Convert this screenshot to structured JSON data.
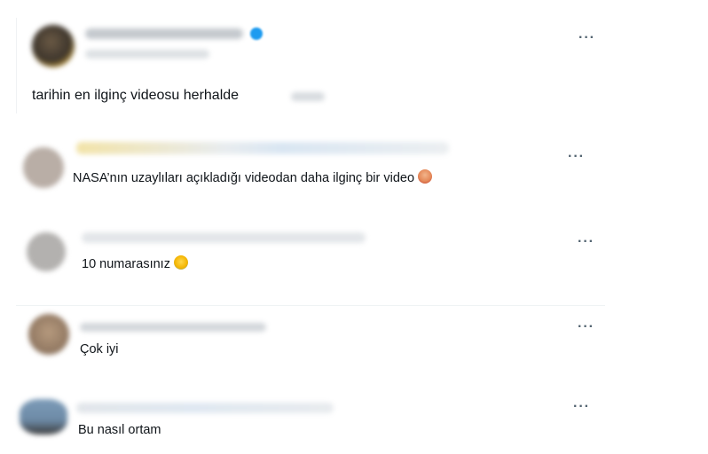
{
  "main_post": {
    "text": "tarihin en ilginç videosu herhalde",
    "more_label": "···"
  },
  "replies": [
    {
      "text": "NASA’nın uzaylıları açıkladığı videodan daha ilginç bir video",
      "more_label": "···"
    },
    {
      "text": "10 numarasınız",
      "more_label": "···"
    },
    {
      "text": "Çok iyi",
      "more_label": "···"
    },
    {
      "text": "Bu nasıl ortam",
      "more_label": "···"
    }
  ],
  "colors": {
    "text": "#0f1419",
    "muted": "#536471",
    "verified": "#1d9bf0",
    "divider": "#eff3f4"
  }
}
